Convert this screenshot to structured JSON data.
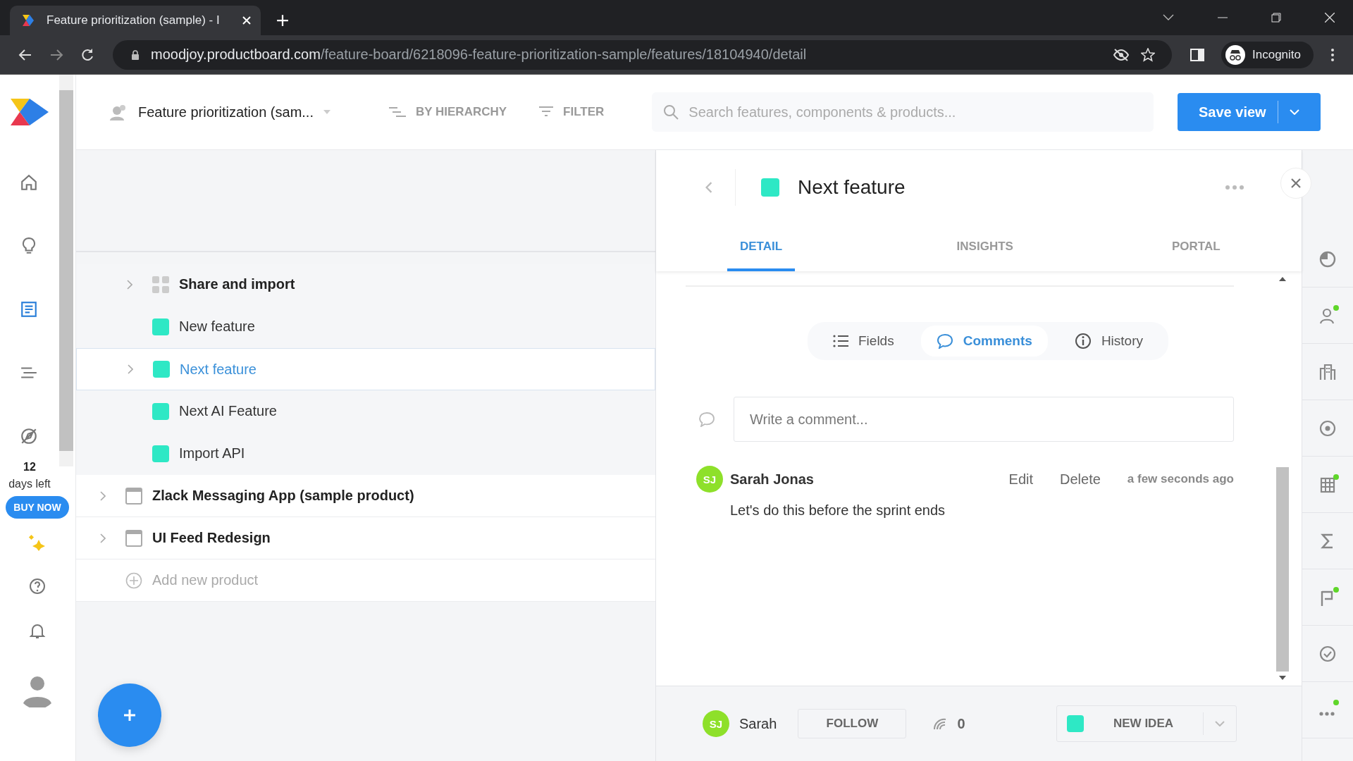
{
  "browser": {
    "tab_title": "Feature prioritization (sample) - I",
    "url_host": "moodjoy.productboard.com",
    "url_path": "/feature-board/6218096-feature-prioritization-sample/features/18104940/detail",
    "profile": "Incognito"
  },
  "rail": {
    "nav": [
      {
        "kind": "home",
        "selected": false
      },
      {
        "kind": "insights",
        "selected": false
      },
      {
        "kind": "features",
        "selected": true
      },
      {
        "kind": "roadmap",
        "selected": false
      },
      {
        "kind": "portal",
        "selected": false
      }
    ],
    "trial_days": "12",
    "trial_label": "days left",
    "buy": "BUY NOW"
  },
  "header": {
    "board": "Feature prioritization (sam...",
    "group_by": "BY HIERARCHY",
    "filter": "FILTER",
    "search_placeholder": "Search features, components & products...",
    "save": "Save view"
  },
  "tree": {
    "items": [
      {
        "name": "Share and import",
        "kind": "component",
        "expandable": true,
        "selected": false
      },
      {
        "name": "New feature",
        "kind": "feature",
        "expandable": false,
        "selected": false
      },
      {
        "name": "Next feature",
        "kind": "feature",
        "expandable": true,
        "selected": true
      },
      {
        "name": "Next AI Feature",
        "kind": "feature",
        "expandable": false,
        "selected": false
      },
      {
        "name": "Import API",
        "kind": "feature",
        "expandable": false,
        "selected": false
      }
    ],
    "products": [
      {
        "name": "Zlack Messaging App (sample product)",
        "expandable": true
      },
      {
        "name": "UI Feed Redesign",
        "expandable": true
      }
    ],
    "add_product": "Add new product"
  },
  "panel": {
    "title": "Next feature",
    "tabs": [
      {
        "label": "DETAIL",
        "selected": true
      },
      {
        "label": "INSIGHTS",
        "selected": false
      },
      {
        "label": "PORTAL",
        "selected": false
      }
    ],
    "segments": [
      {
        "label": "Fields",
        "kind": "fields",
        "selected": false
      },
      {
        "label": "Comments",
        "kind": "comments",
        "selected": true
      },
      {
        "label": "History",
        "kind": "history",
        "selected": false
      }
    ],
    "comment_placeholder": "Write a comment...",
    "comments": [
      {
        "initials": "SJ",
        "author": "Sarah Jonas",
        "edit": "Edit",
        "delete": "Delete",
        "time": "a few seconds ago",
        "text": "Let's do this before the sprint ends"
      }
    ],
    "footer": {
      "initials": "SJ",
      "owner": "Sarah",
      "follow": "FOLLOW",
      "followers": "0",
      "status": "NEW IDEA"
    }
  },
  "side_tools": [
    {
      "kind": "pie",
      "notification": false
    },
    {
      "kind": "person",
      "notification": true
    },
    {
      "kind": "building",
      "notification": false
    },
    {
      "kind": "target",
      "notification": false
    },
    {
      "kind": "grid",
      "notification": true
    },
    {
      "kind": "sigma",
      "notification": false
    },
    {
      "kind": "flag",
      "notification": true
    },
    {
      "kind": "check",
      "notification": false
    },
    {
      "kind": "more",
      "notification": true
    }
  ]
}
